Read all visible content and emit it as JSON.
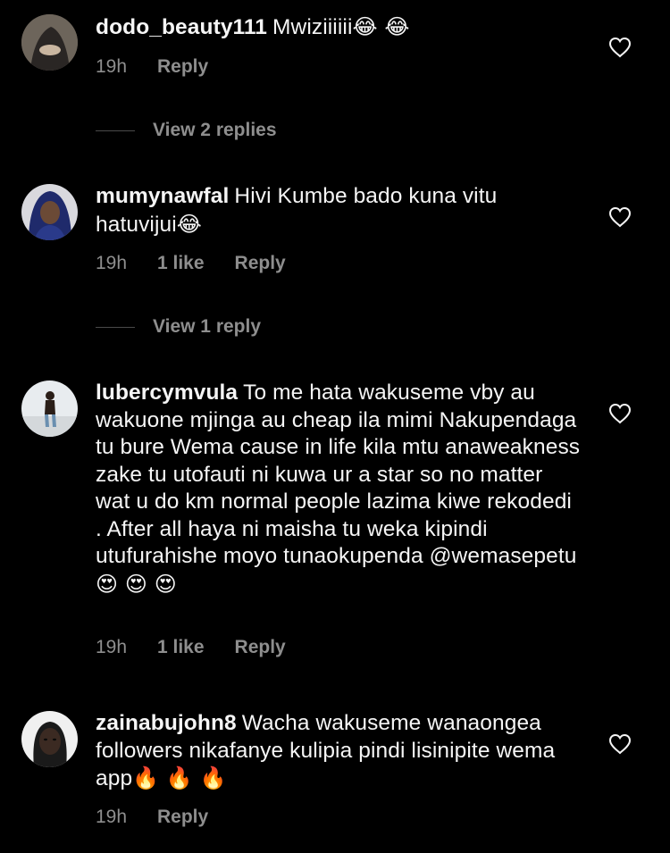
{
  "comments": [
    {
      "username": "dodo_beauty111",
      "text": "Mwiziiiiii",
      "emojis": "😂 😂",
      "time": "19h",
      "likes": "",
      "reply_label": "Reply",
      "view_replies": "View 2 replies",
      "avatar_icon": "avatar-photo"
    },
    {
      "username": "mumynawfal",
      "text": "Hivi Kumbe bado kuna vitu hatuvijui",
      "emojis": "😂",
      "time": "19h",
      "likes": "1 like",
      "reply_label": "Reply",
      "view_replies": "View 1 reply",
      "avatar_icon": "avatar-photo"
    },
    {
      "username": "lubercymvula",
      "text": "To me hata wakuseme vby au wakuone mjinga au cheap ila mimi Nakupendaga tu bure Wema cause in life kila mtu anaweakness zake tu utofauti ni kuwa ur a star so no matter wat u do km normal people lazima kiwe rekodedi . After all haya ni maisha tu weka kipindi utufurahishe moyo tunaokupenda @wemasepetu",
      "emojis": "😍 😍 😍",
      "time": "19h",
      "likes": "1 like",
      "reply_label": "Reply",
      "view_replies": "",
      "avatar_icon": "avatar-photo"
    },
    {
      "username": "zainabujohn8",
      "text": "Wacha wakuseme wanaongea followers nikafanye kulipia pindi lisinipite wema app",
      "emojis": "🔥 🔥 🔥",
      "time": "19h",
      "likes": "",
      "reply_label": "Reply",
      "view_replies": "",
      "avatar_icon": "avatar-photo"
    }
  ],
  "colors": {
    "background": "#000000",
    "text": "#f5f5f5",
    "secondary": "#8e8e8e"
  }
}
